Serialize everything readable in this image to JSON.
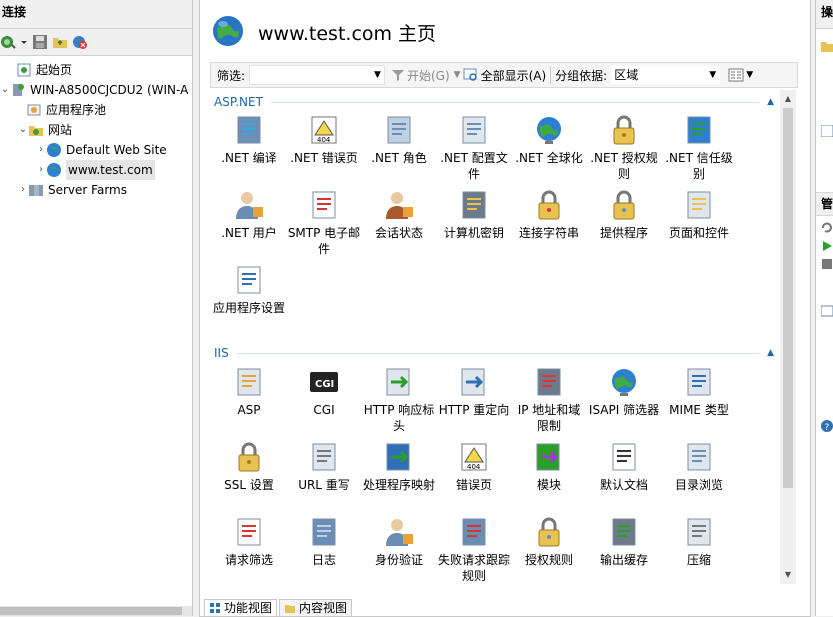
{
  "connections": {
    "header": "连接",
    "tree": [
      {
        "label": "起始页",
        "icon": "start-page-icon",
        "toggle": ""
      },
      {
        "label": "WIN-A8500CJCDU2 (WIN-A",
        "icon": "server-icon",
        "toggle": "⌄"
      },
      {
        "label": "应用程序池",
        "icon": "app-pool-icon",
        "toggle": ""
      },
      {
        "label": "网站",
        "icon": "sites-folder-icon",
        "toggle": "⌄"
      },
      {
        "label": "Default Web Site",
        "icon": "globe-icon",
        "toggle": "›"
      },
      {
        "label": "www.test.com",
        "icon": "globe-icon",
        "toggle": "›"
      },
      {
        "label": "Server Farms",
        "icon": "server-farms-icon",
        "toggle": "›"
      }
    ]
  },
  "page": {
    "title": "www.test.com 主页"
  },
  "filter_bar": {
    "filter_label": "筛选:",
    "filter_value": "",
    "start_label": "开始(G)",
    "show_all_label": "全部显示(A)",
    "groupby_label": "分组依据:",
    "groupby_value": "区域"
  },
  "groups": [
    {
      "name": "ASP.NET",
      "features": [
        {
          "label": ".NET 编译",
          "icon": "net-compilation-icon"
        },
        {
          "label": ".NET 错误页",
          "icon": "net-error-pages-icon"
        },
        {
          "label": ".NET 角色",
          "icon": "net-roles-icon"
        },
        {
          "label": ".NET 配置文件",
          "icon": "net-profile-icon"
        },
        {
          "label": ".NET 全球化",
          "icon": "net-globalization-icon"
        },
        {
          "label": ".NET 授权规则",
          "icon": "net-authorization-icon"
        },
        {
          "label": ".NET 信任级别",
          "icon": "net-trust-levels-icon"
        },
        {
          "label": ".NET 用户",
          "icon": "net-users-icon"
        },
        {
          "label": "SMTP 电子邮件",
          "icon": "smtp-email-icon"
        },
        {
          "label": "会话状态",
          "icon": "session-state-icon"
        },
        {
          "label": "计算机密钥",
          "icon": "machine-key-icon"
        },
        {
          "label": "连接字符串",
          "icon": "connection-strings-icon"
        },
        {
          "label": "提供程序",
          "icon": "providers-icon"
        },
        {
          "label": "页面和控件",
          "icon": "pages-controls-icon"
        },
        {
          "label": "应用程序设置",
          "icon": "app-settings-icon"
        }
      ]
    },
    {
      "name": "IIS",
      "features": [
        {
          "label": "ASP",
          "icon": "asp-icon"
        },
        {
          "label": "CGI",
          "icon": "cgi-icon"
        },
        {
          "label": "HTTP 响应标头",
          "icon": "http-response-headers-icon"
        },
        {
          "label": "HTTP 重定向",
          "icon": "http-redirect-icon"
        },
        {
          "label": "IP 地址和域限制",
          "icon": "ip-restrictions-icon"
        },
        {
          "label": "ISAPI 筛选器",
          "icon": "isapi-filters-icon"
        },
        {
          "label": "MIME 类型",
          "icon": "mime-types-icon"
        },
        {
          "label": "SSL 设置",
          "icon": "ssl-settings-icon"
        },
        {
          "label": "URL 重写",
          "icon": "url-rewrite-icon"
        },
        {
          "label": "处理程序映射",
          "icon": "handler-mappings-icon"
        },
        {
          "label": "错误页",
          "icon": "error-pages-icon"
        },
        {
          "label": "模块",
          "icon": "modules-icon"
        },
        {
          "label": "默认文档",
          "icon": "default-document-icon"
        },
        {
          "label": "目录浏览",
          "icon": "directory-browsing-icon"
        },
        {
          "label": "请求筛选",
          "icon": "request-filtering-icon"
        },
        {
          "label": "日志",
          "icon": "logging-icon"
        },
        {
          "label": "身份验证",
          "icon": "authentication-icon"
        },
        {
          "label": "失败请求跟踪规则",
          "icon": "failed-request-tracing-icon"
        },
        {
          "label": "授权规则",
          "icon": "authorization-rules-icon"
        },
        {
          "label": "输出缓存",
          "icon": "output-caching-icon"
        },
        {
          "label": "压缩",
          "icon": "compression-icon"
        }
      ]
    }
  ],
  "view_tabs": [
    {
      "label": "功能视图",
      "active": true
    },
    {
      "label": "内容视图",
      "active": false
    }
  ],
  "actions": {
    "header": "操作",
    "manage_header": "管理"
  },
  "colors": {
    "group_header": "#1c6aa1",
    "annotation_arrow": "#e8262a"
  }
}
